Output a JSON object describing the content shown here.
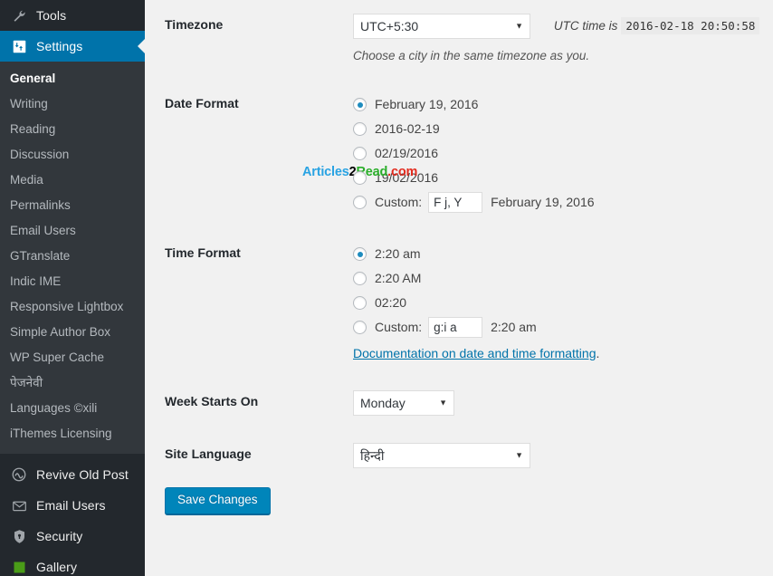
{
  "sidebar": {
    "top_items": [
      {
        "label": "Tools",
        "icon": "wrench-icon",
        "current": false
      },
      {
        "label": "Settings",
        "icon": "settings-sliders-icon",
        "current": true
      }
    ],
    "submenu": [
      {
        "label": "General",
        "active": true
      },
      {
        "label": "Writing",
        "active": false
      },
      {
        "label": "Reading",
        "active": false
      },
      {
        "label": "Discussion",
        "active": false
      },
      {
        "label": "Media",
        "active": false
      },
      {
        "label": "Permalinks",
        "active": false
      },
      {
        "label": "Email Users",
        "active": false
      },
      {
        "label": "GTranslate",
        "active": false
      },
      {
        "label": "Indic IME",
        "active": false
      },
      {
        "label": "Responsive Lightbox",
        "active": false
      },
      {
        "label": "Simple Author Box",
        "active": false
      },
      {
        "label": "WP Super Cache",
        "active": false
      },
      {
        "label": "पेजनेवी",
        "active": false
      },
      {
        "label": "Languages ©xili",
        "active": false
      },
      {
        "label": "iThemes Licensing",
        "active": false
      }
    ],
    "bottom_items": [
      {
        "label": "Revive Old Post",
        "icon": "circle-arrow-icon"
      },
      {
        "label": "Email Users",
        "icon": "envelope-icon"
      },
      {
        "label": "Security",
        "icon": "shield-icon"
      },
      {
        "label": "Gallery",
        "icon": "green-square-icon"
      }
    ]
  },
  "watermark": {
    "part1": "Articles",
    "part2": "2",
    "part3": "Read",
    "part4": ".com"
  },
  "form": {
    "timezone": {
      "label": "Timezone",
      "selected": "UTC+5:30",
      "options": [
        "UTC+5:30"
      ],
      "utc_note": "UTC time is",
      "utc_time": "2016-02-18 20:50:58",
      "description": "Choose a city in the same timezone as you."
    },
    "date_format": {
      "label": "Date Format",
      "options": [
        {
          "text": "February 19, 2016",
          "checked": true
        },
        {
          "text": "2016-02-19",
          "checked": false
        },
        {
          "text": "02/19/2016",
          "checked": false
        },
        {
          "text": "19/02/2016",
          "checked": false
        }
      ],
      "custom_label": "Custom:",
      "custom_value": "F j, Y",
      "custom_preview": "February 19, 2016",
      "custom_checked": false
    },
    "time_format": {
      "label": "Time Format",
      "options": [
        {
          "text": "2:20 am",
          "checked": true
        },
        {
          "text": "2:20 AM",
          "checked": false
        },
        {
          "text": "02:20",
          "checked": false
        }
      ],
      "custom_label": "Custom:",
      "custom_value": "g:i a",
      "custom_preview": "2:20 am",
      "custom_checked": false,
      "doc_link": "Documentation on date and time formatting",
      "doc_period": "."
    },
    "week_starts": {
      "label": "Week Starts On",
      "selected": "Monday",
      "options": [
        "Monday"
      ]
    },
    "site_language": {
      "label": "Site Language",
      "selected": "हिन्दी",
      "options": [
        "हिन्दी"
      ]
    },
    "submit_label": "Save Changes"
  },
  "colors": {
    "accent": "#0073aa",
    "button": "#0085ba",
    "sidebar_bg": "#23282d",
    "submenu_bg": "#32373c",
    "content_bg": "#f1f1f1",
    "radio_dot": "#1e8cbe"
  }
}
